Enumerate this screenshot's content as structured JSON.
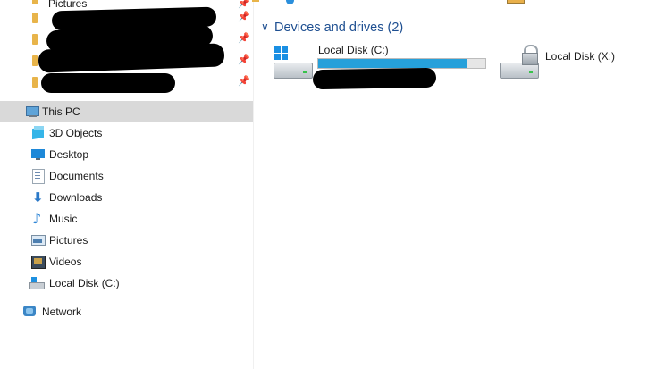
{
  "quick_access": {
    "top_item_label": "Pictures"
  },
  "nav": {
    "items": [
      {
        "label": "This PC",
        "icon": "computer-icon",
        "selected": true
      },
      {
        "label": "3D Objects",
        "icon": "cube-icon"
      },
      {
        "label": "Desktop",
        "icon": "desktop-icon"
      },
      {
        "label": "Documents",
        "icon": "document-icon"
      },
      {
        "label": "Downloads",
        "icon": "download-arrow-icon"
      },
      {
        "label": "Music",
        "icon": "music-note-icon"
      },
      {
        "label": "Pictures",
        "icon": "pictures-icon"
      },
      {
        "label": "Videos",
        "icon": "film-icon"
      },
      {
        "label": "Local Disk (C:)",
        "icon": "disk-icon"
      }
    ],
    "network_label": "Network"
  },
  "main": {
    "group_title": "Devices and drives (2)",
    "drives": [
      {
        "name": "Local Disk (C:)",
        "usage_fraction": 0.89,
        "icon": "windows-drive-icon"
      },
      {
        "name": "Local Disk (X:)",
        "icon": "locked-drive-icon"
      }
    ]
  },
  "colors": {
    "accent": "#26a0da",
    "group_title": "#1e4f91",
    "selected_bg": "#d9d9d9"
  }
}
